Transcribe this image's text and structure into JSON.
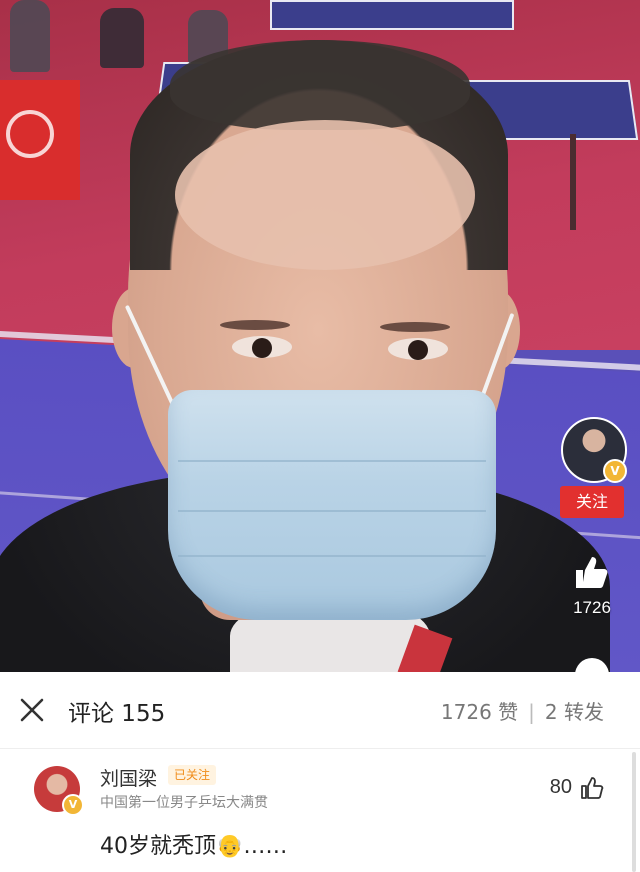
{
  "video": {
    "rail": {
      "follow_label": "关注",
      "like_count": "1726",
      "verified_badge": "V"
    }
  },
  "comments_sheet": {
    "title": "评论 155",
    "likes_stat": "1726 赞",
    "reposts_stat": "2 转发",
    "close_icon": "close-icon",
    "comment": {
      "author": "刘国梁",
      "tag": "已关注",
      "description": "中国第一位男子乒坛大满贯",
      "text": "40岁就秃顶👴……",
      "likes": "80",
      "verified_badge": "V"
    }
  },
  "colors": {
    "follow_red": "#e2302f",
    "tag_orange": "#f08c1a",
    "verified_gold": "#f2b636"
  }
}
